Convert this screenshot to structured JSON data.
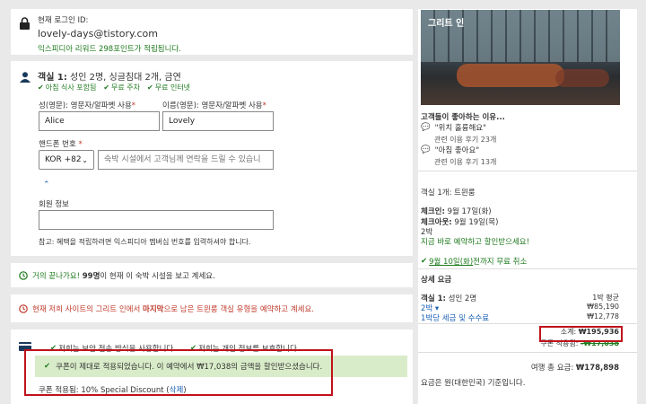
{
  "login": {
    "label": "현재 로그인 ID:",
    "email": "lovely-days@tistory.com",
    "reward": "익스피디아 리워드 298포인트가 적립됩니다."
  },
  "room": {
    "title_prefix": "객실 1:",
    "title_rest": " 성인 2명, 싱글침대 2개, 금연",
    "amenities": [
      "아침 식사 포함됨",
      "무료 주차",
      "무료 인터넷"
    ],
    "last_name_label": "성(영문): 영문자/알파벳 사용",
    "last_name_value": "Alice",
    "first_name_label": "이름(영문): 영문자/알파벳 사용",
    "first_name_value": "Lovely",
    "phone_label": "핸드폰 번호",
    "country_code": "KOR +82",
    "phone_placeholder": "숙박 시설에서 고객님께 연락을 드릴 수 있습니",
    "member_label": "회원 정보",
    "member_note": "참고: 혜택을 적립하려면 익스피디아 멤버십 번호를 입력하셔야 합니다."
  },
  "notice": {
    "a": "거의 끝나가요! ",
    "b": "99명",
    "c": "이 현재 이 숙박 시설을 보고 계세요."
  },
  "urgency": {
    "a": "현재 저희 사이트의 그리트 인에서 ",
    "b": "마지막",
    "c": "으로 남은 트윈룸 객실 유형을 예약하고 계세요."
  },
  "pay": {
    "secure1": "저희는 보안 전송 방식을 사용합니다.",
    "secure2": "저희는 개인 정보를 보호합니다.",
    "coupon_msg": "쿠폰이 제대로 적용되었습니다. 이 예약에서 ₩17,038의 금액을 할인받으셨습니다.",
    "coupon_applied_label": "쿠폰 적용됨: 10% Special Discount (",
    "coupon_remove": "삭제",
    "coupon_close": ")"
  },
  "hotel": {
    "name": "그리트 인",
    "reasons_title": "고객들이 좋아하는 이유...",
    "reasons": [
      {
        "quote": "\"위치 훌륭해요\"",
        "count": "관련 이용 후기 23개"
      },
      {
        "quote": "\"아침 좋아요\"",
        "count": "관련 이용 후기 13개"
      }
    ],
    "room_line": "객실 1개: 트윈룸",
    "checkin_label": "체크인:",
    "checkin_value": " 9월 17일(화)",
    "checkout_label": "체크아웃:",
    "checkout_value": " 9월 19일(목)",
    "nights": "2박",
    "book_now": "지금 바로 예약하고 할인받으세요!",
    "free_cancel_date": "9월 10일(화)",
    "free_cancel_rest": " 전까지 무료 취소",
    "price_title": "상세 요금",
    "room_guest_prefix": "객실 1:",
    "room_guest_rest": " 성인 2명",
    "avg_label": "1박 평균",
    "nights_link": "2박 ▾",
    "nights_price": "₩85,190",
    "tax_link": "1박당 세금 및 수수료",
    "tax_price": "₩12,778",
    "subtotal_label": "소계:",
    "subtotal_value": "₩195,936",
    "coupon_label": "쿠폰 적용됨:",
    "coupon_value": "-₩17,038",
    "total_label": "여행 총 요금:",
    "total_value": "₩178,898",
    "currency_note": "요금은 원(대한민국) 기준입니다."
  }
}
